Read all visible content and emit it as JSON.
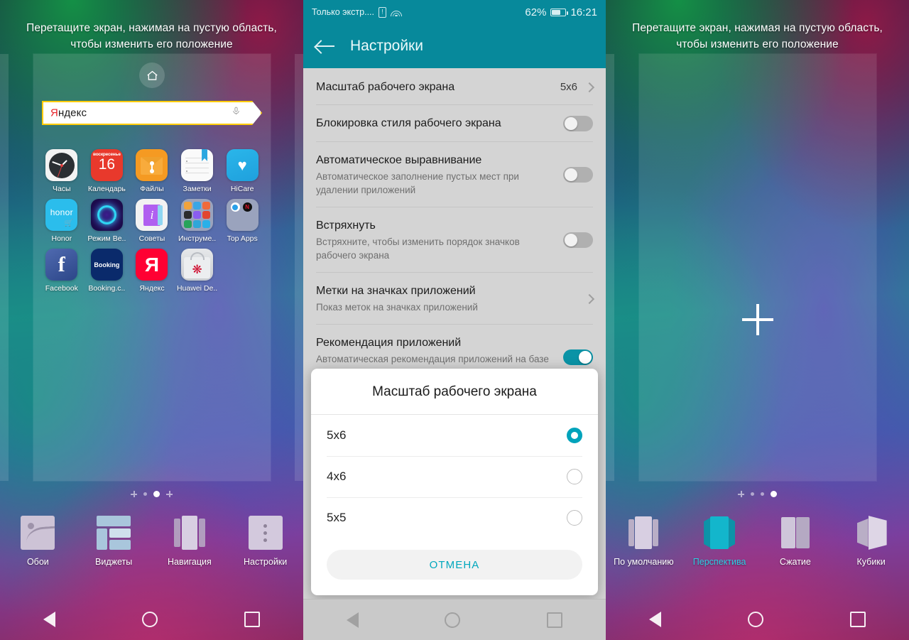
{
  "hint_text": "Перетащите экран, нажимая на пустую область, чтобы изменить его положение",
  "home_panel": {
    "home_icon": "home-icon",
    "widget": {
      "brand_first_letter": "Я",
      "brand_rest": "ндекс",
      "mic_icon": "microphone-icon"
    },
    "apps": [
      {
        "label": "Часы",
        "icon": "clock-icon"
      },
      {
        "label": "Календарь",
        "icon": "calendar-icon",
        "weekday": "воскресенье",
        "day": "16"
      },
      {
        "label": "Файлы",
        "icon": "files-icon"
      },
      {
        "label": "Заметки",
        "icon": "notes-icon"
      },
      {
        "label": "HiCare",
        "icon": "hicare-heart-icon"
      },
      {
        "label": "Honor",
        "icon": "honor-store-icon",
        "brand": "honor"
      },
      {
        "label": "Режим Ве..",
        "icon": "neon-ring-icon"
      },
      {
        "label": "Советы",
        "icon": "tips-book-icon",
        "glyph": "i"
      },
      {
        "label": "Инструме..",
        "icon": "tools-folder-icon"
      },
      {
        "label": "Top Apps",
        "icon": "top-apps-folder-icon"
      },
      {
        "label": "Facebook",
        "icon": "facebook-icon",
        "glyph": "f"
      },
      {
        "label": "Booking.c..",
        "icon": "booking-icon",
        "glyph": "Booking"
      },
      {
        "label": "Яндекс",
        "icon": "yandex-icon",
        "glyph": "Я"
      },
      {
        "label": "Huawei De..",
        "icon": "huawei-appgallery-icon"
      }
    ],
    "page_indicator": [
      "plus",
      "dot",
      "active",
      "plus"
    ],
    "tools": [
      {
        "label": "Обои",
        "icon": "wallpaper-icon",
        "active": false
      },
      {
        "label": "Виджеты",
        "icon": "widgets-icon",
        "active": false
      },
      {
        "label": "Навигация",
        "icon": "navigation-icon",
        "active": false
      },
      {
        "label": "Настройки",
        "icon": "settings-dots-icon",
        "active": false
      }
    ]
  },
  "settings_panel": {
    "status_bar": {
      "carrier": "Только экстр....",
      "sim_icon": "sim-alert-icon",
      "wifi_icon": "wifi-icon",
      "battery_percent": "62%",
      "battery_icon": "battery-icon",
      "time": "16:21"
    },
    "header": {
      "back_icon": "back-arrow-icon",
      "title": "Настройки"
    },
    "items": [
      {
        "title": "Масштаб рабочего экрана",
        "subtitle": "",
        "value": "5x6",
        "control": "chevron",
        "toggle_on": false
      },
      {
        "title": "Блокировка стиля рабочего экрана",
        "subtitle": "",
        "value": "",
        "control": "switch",
        "toggle_on": false
      },
      {
        "title": "Автоматическое выравнивание",
        "subtitle": "Автоматическое заполнение пустых мест при удалении приложений",
        "value": "",
        "control": "switch",
        "toggle_on": false
      },
      {
        "title": "Встряхнуть",
        "subtitle": "Встряхните, чтобы изменить порядок значков рабочего экрана",
        "value": "",
        "control": "switch",
        "toggle_on": false
      },
      {
        "title": "Метки на значках приложений",
        "subtitle": "Показ меток на значках приложений",
        "value": "",
        "control": "chevron",
        "toggle_on": false
      },
      {
        "title": "Рекомендация приложений",
        "subtitle": "Автоматическая рекомендация приложений на базе сценариев использования телефона",
        "value": "",
        "control": "switch",
        "toggle_on": true
      }
    ],
    "dialog": {
      "title": "Масштаб рабочего экрана",
      "options": [
        {
          "label": "5x6",
          "selected": true
        },
        {
          "label": "4x6",
          "selected": false
        },
        {
          "label": "5x5",
          "selected": false
        }
      ],
      "cancel_label": "ОТМЕНА"
    }
  },
  "effects_panel": {
    "add_icon": "plus-icon",
    "page_indicator": [
      "plus",
      "dot",
      "dot",
      "active"
    ],
    "effects": [
      {
        "label": "По умолчанию",
        "icon": "effect-default-icon",
        "active": false
      },
      {
        "label": "Перспектива",
        "icon": "effect-perspective-icon",
        "active": true
      },
      {
        "label": "Сжатие",
        "icon": "effect-squeeze-icon",
        "active": false
      },
      {
        "label": "Кубики",
        "icon": "effect-cube-icon",
        "active": false
      }
    ]
  },
  "nav_bar": {
    "back_icon": "nav-back-icon",
    "home_icon": "nav-home-icon",
    "recents_icon": "nav-recents-icon"
  },
  "colors": {
    "accent_teal": "#07899b",
    "toggle_on": "#0a93a6",
    "radio_selected": "#00a3bb",
    "cancel_text": "#00a7bd",
    "active_effect_label": "#2ad1e6",
    "yandex_border": "#ffcc00",
    "yandex_red": "#e8242a"
  }
}
